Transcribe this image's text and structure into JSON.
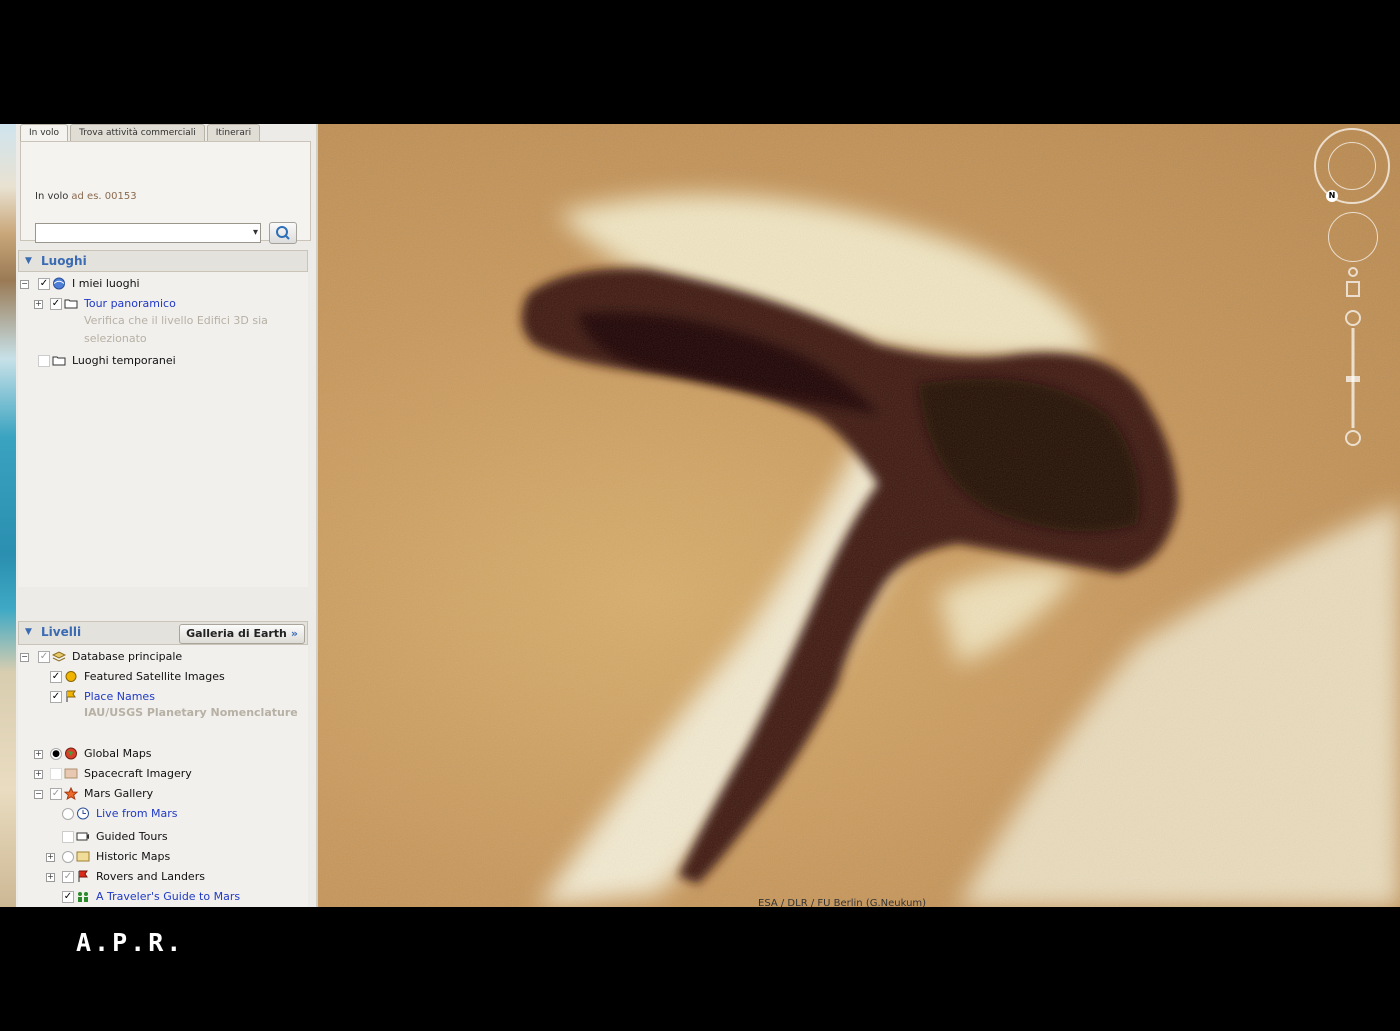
{
  "watermark": "A.P.R.",
  "search": {
    "tabs": [
      "In volo",
      "Trova attività commerciali",
      "Itinerari"
    ],
    "fly_label": "In volo",
    "fly_hint": "ad es. 00153",
    "fly_value": ""
  },
  "places": {
    "title": "Luoghi",
    "items": [
      {
        "label": "I miei luoghi",
        "checked": true,
        "icon": "globe-icon"
      },
      {
        "label": "Tour panoramico",
        "checked": true,
        "icon": "folder-icon",
        "link": true
      },
      {
        "label": "Verifica che il livello Edifici 3D sia",
        "desc": true
      },
      {
        "label": "selezionato",
        "desc": true
      },
      {
        "label": "Luoghi temporanei",
        "checked": false,
        "icon": "folder-icon"
      }
    ]
  },
  "layers": {
    "title": "Livelli",
    "gallery_button": "Galleria di Earth",
    "items": [
      {
        "label": "Database principale",
        "icon": "layers-icon"
      },
      {
        "label": "Featured Satellite Images",
        "icon": "circle-icon"
      },
      {
        "label": "Place Names",
        "icon": "flag-icon",
        "link": true
      },
      {
        "label": "IAU/USGS Planetary Nomenclature",
        "desc": true
      },
      {
        "label": "Global Maps",
        "icon": "globe-icon"
      },
      {
        "label": "Spacecraft Imagery",
        "icon": "image-icon"
      },
      {
        "label": "Mars Gallery",
        "icon": "star-icon"
      },
      {
        "label": "Live from Mars",
        "icon": "clock-icon",
        "link": true
      },
      {
        "label": "Guided Tours",
        "icon": "camera-icon"
      },
      {
        "label": "Historic Maps",
        "icon": "map-icon"
      },
      {
        "label": "Rovers and Landers",
        "icon": "flag-icon"
      },
      {
        "label": "A Traveler's Guide to Mars",
        "icon": "people-icon",
        "link": true
      }
    ]
  },
  "map": {
    "attribution": "ESA / DLR / FU Berlin (G.Neukum)"
  }
}
